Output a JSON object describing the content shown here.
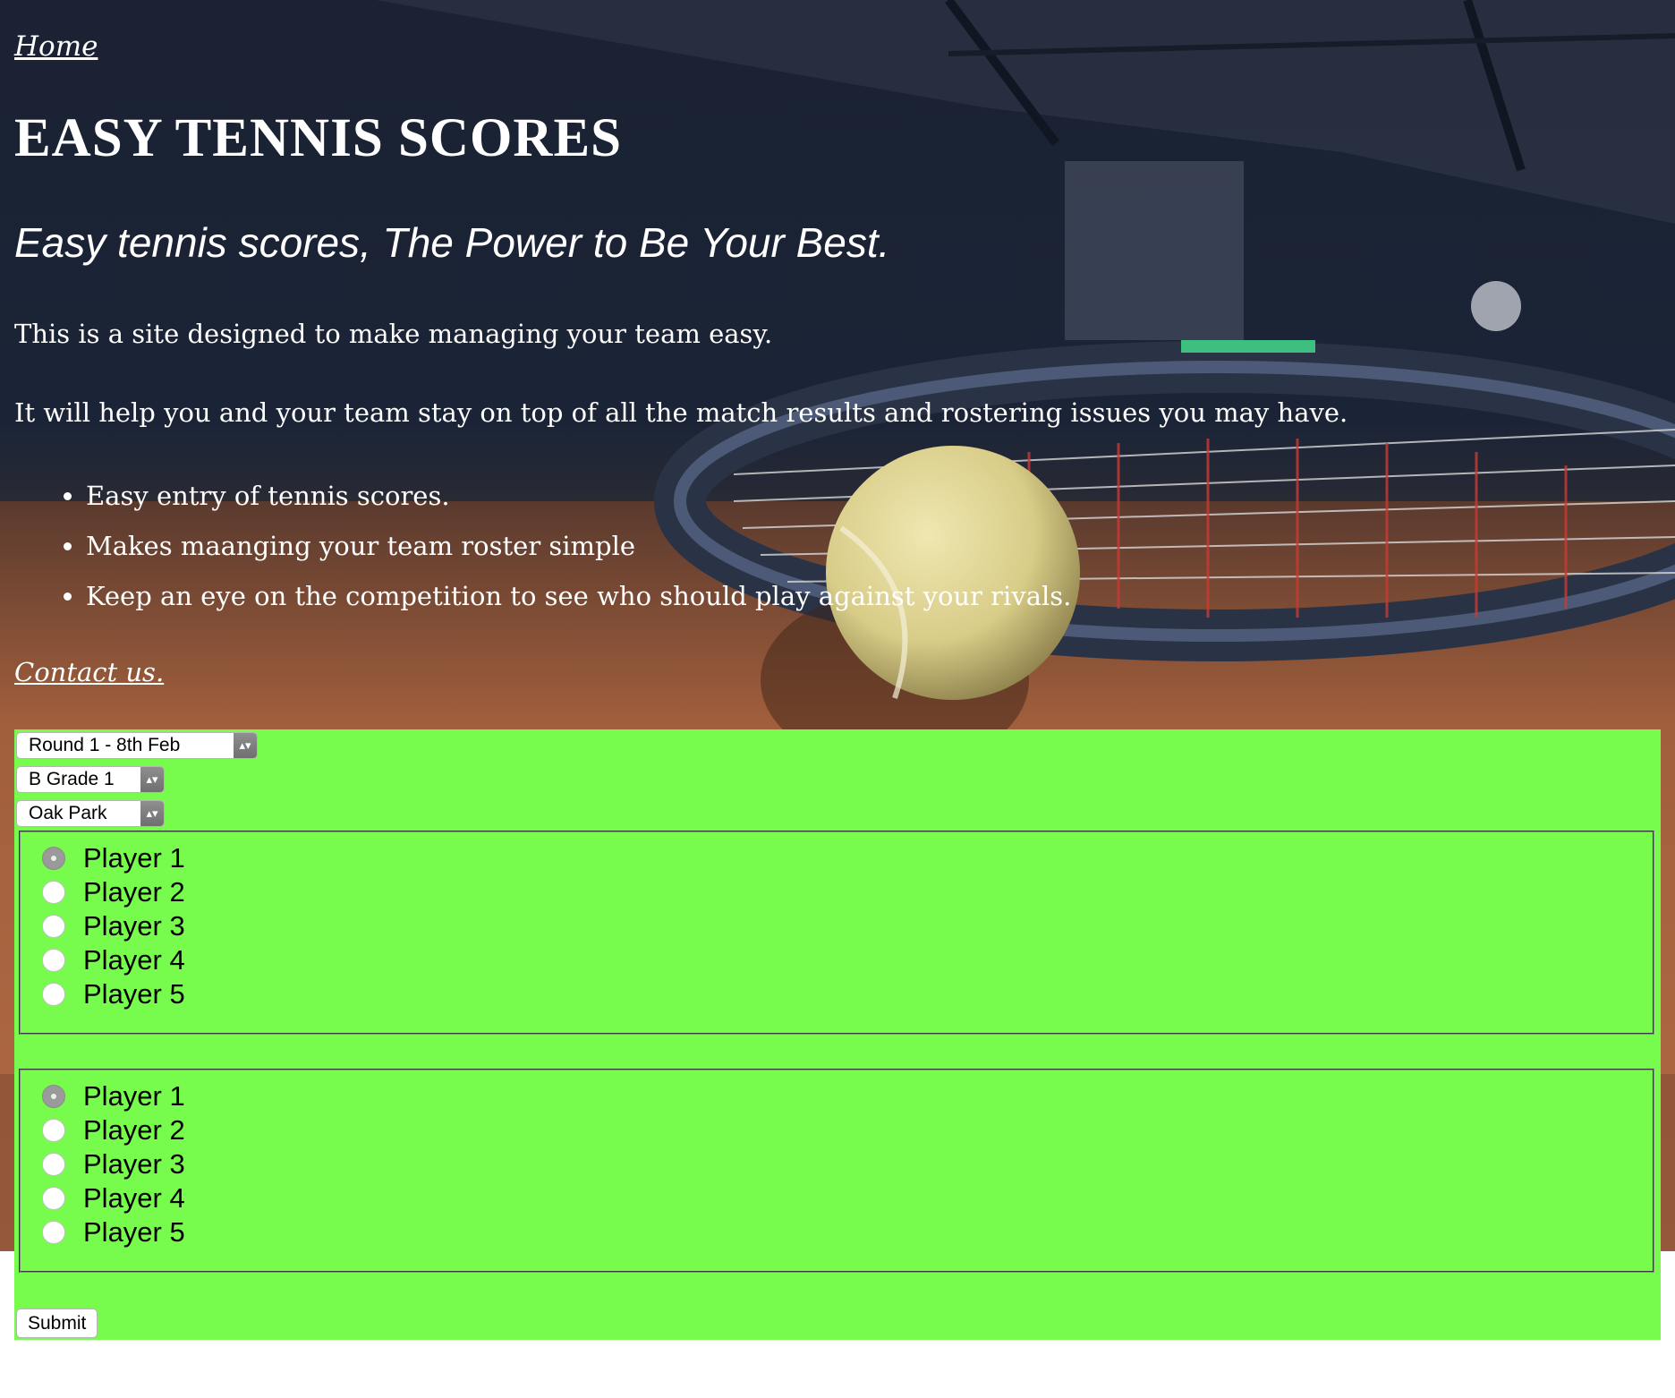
{
  "nav": {
    "home_label": "Home"
  },
  "header": {
    "title": "EASY TENNIS SCORES",
    "tagline": "Easy tennis scores, The Power to Be Your Best."
  },
  "intro": {
    "p1": "This is a site designed to make managing your team easy.",
    "p2": "It will help you and your team stay on top of all the match results and rostering issues you may have."
  },
  "features": [
    "Easy entry of tennis scores.",
    "Makes maanging your team roster simple",
    "Keep an eye on the competition to see who should play against your rivals."
  ],
  "contact": {
    "label": "Contact us."
  },
  "form": {
    "round_select": "Round 1 - 8th Feb",
    "grade_select": "B Grade 1",
    "club_select": "Oak Park",
    "group_1": {
      "options": [
        "Player 1",
        "Player 2",
        "Player 3",
        "Player 4",
        "Player 5"
      ],
      "selected": "Player 1"
    },
    "group_2": {
      "options": [
        "Player 1",
        "Player 2",
        "Player 3",
        "Player 4",
        "Player 5"
      ],
      "selected": "Player 1"
    },
    "submit_label": "Submit"
  },
  "colors": {
    "form_background": "#77fb4d",
    "header_text": "#ffffff"
  }
}
